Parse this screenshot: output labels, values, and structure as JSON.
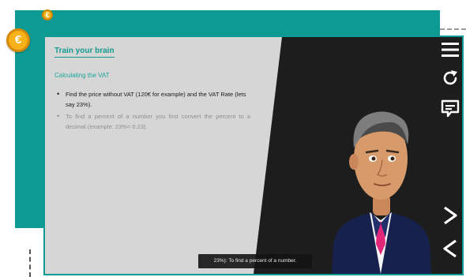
{
  "slide": {
    "title": "Train your brain",
    "subtitle": "Calculating the VAT",
    "bullets": [
      "Find the price without VAT (120€ for example) and the VAT Rate (lets say 23%).",
      "To find a percent of a number you first convert the percent to a decimal (example: 23%= 0.23)."
    ]
  },
  "caption": {
    "text": "23%): To find a percent of a number."
  },
  "badges": {
    "small_symbol": "€",
    "big_symbol": "€"
  },
  "controls": {
    "menu_icon": "hamburger-menu-icon",
    "reload_icon": "reload-icon",
    "notes_icon": "notes-icon",
    "next_icon": "chevron-right-icon",
    "prev_icon": "chevron-left-icon"
  },
  "colors": {
    "frame_teal": "#0e9a94",
    "slide_bg": "#d6d6d6",
    "stage_bg": "#1d1d1d",
    "title_teal": "#139a8f",
    "coin_gold": "#f5b31a"
  }
}
